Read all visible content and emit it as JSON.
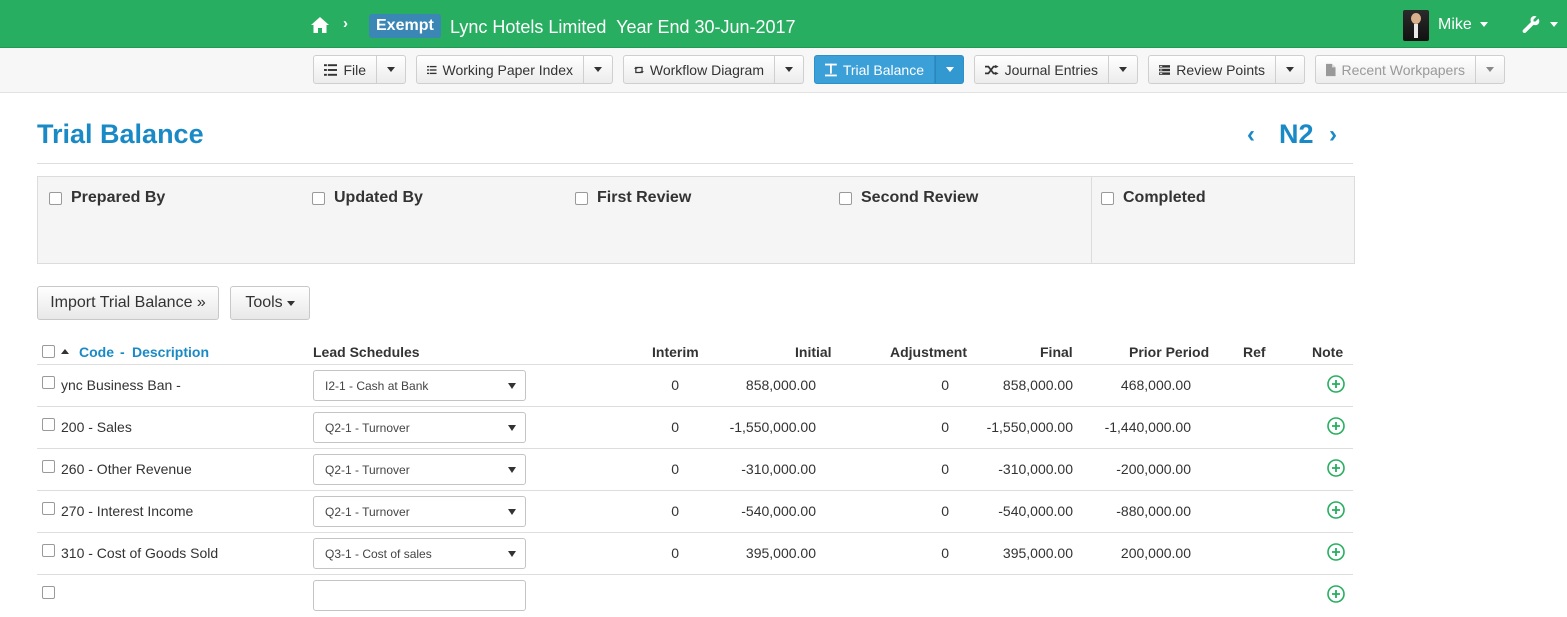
{
  "topbar": {
    "badge": "Exempt",
    "client": "Lync Hotels Limited",
    "period": "Year End 30-Jun-2017",
    "user": "Mike",
    "brand_color": "#27ae60"
  },
  "toolbar": {
    "file": "File",
    "working_paper_index": "Working Paper Index",
    "workflow_diagram": "Workflow Diagram",
    "trial_balance": "Trial Balance",
    "journal_entries": "Journal Entries",
    "review_points": "Review Points",
    "recent_workpapers": "Recent Workpapers",
    "active_color": "#3ca0d8"
  },
  "page": {
    "title": "Trial Balance",
    "code": "N2",
    "prev_icon": "chevron-left-icon",
    "next_icon": "chevron-right-icon"
  },
  "signoff": {
    "prepared_by": "Prepared By",
    "updated_by": "Updated By",
    "first_review": "First Review",
    "second_review": "Second Review",
    "completed": "Completed"
  },
  "actions": {
    "import": "Import Trial Balance »",
    "tools": "Tools"
  },
  "table": {
    "headers": {
      "code": "Code",
      "sep": "-",
      "description": "Description",
      "lead_schedules": "Lead Schedules",
      "interim": "Interim",
      "initial": "Initial",
      "adjustment": "Adjustment",
      "final": "Final",
      "prior_period": "Prior Period",
      "ref": "Ref",
      "note": "Note"
    },
    "rows": [
      {
        "account": "ync Business Ban -",
        "lead": "I2-1 - Cash at Bank",
        "interim": "0",
        "initial": "858,000.00",
        "adjustment": "0",
        "final": "858,000.00",
        "prior": "468,000.00"
      },
      {
        "account": "200 - Sales",
        "lead": "Q2-1 - Turnover",
        "interim": "0",
        "initial": "-1,550,000.00",
        "adjustment": "0",
        "final": "-1,550,000.00",
        "prior": "-1,440,000.00"
      },
      {
        "account": "260 - Other Revenue",
        "lead": "Q2-1 - Turnover",
        "interim": "0",
        "initial": "-310,000.00",
        "adjustment": "0",
        "final": "-310,000.00",
        "prior": "-200,000.00"
      },
      {
        "account": "270 - Interest Income",
        "lead": "Q2-1 - Turnover",
        "interim": "0",
        "initial": "-540,000.00",
        "adjustment": "0",
        "final": "-540,000.00",
        "prior": "-880,000.00"
      },
      {
        "account": "310 - Cost of Goods Sold",
        "lead": "Q3-1 - Cost of sales",
        "interim": "0",
        "initial": "395,000.00",
        "adjustment": "0",
        "final": "395,000.00",
        "prior": "200,000.00"
      }
    ]
  }
}
